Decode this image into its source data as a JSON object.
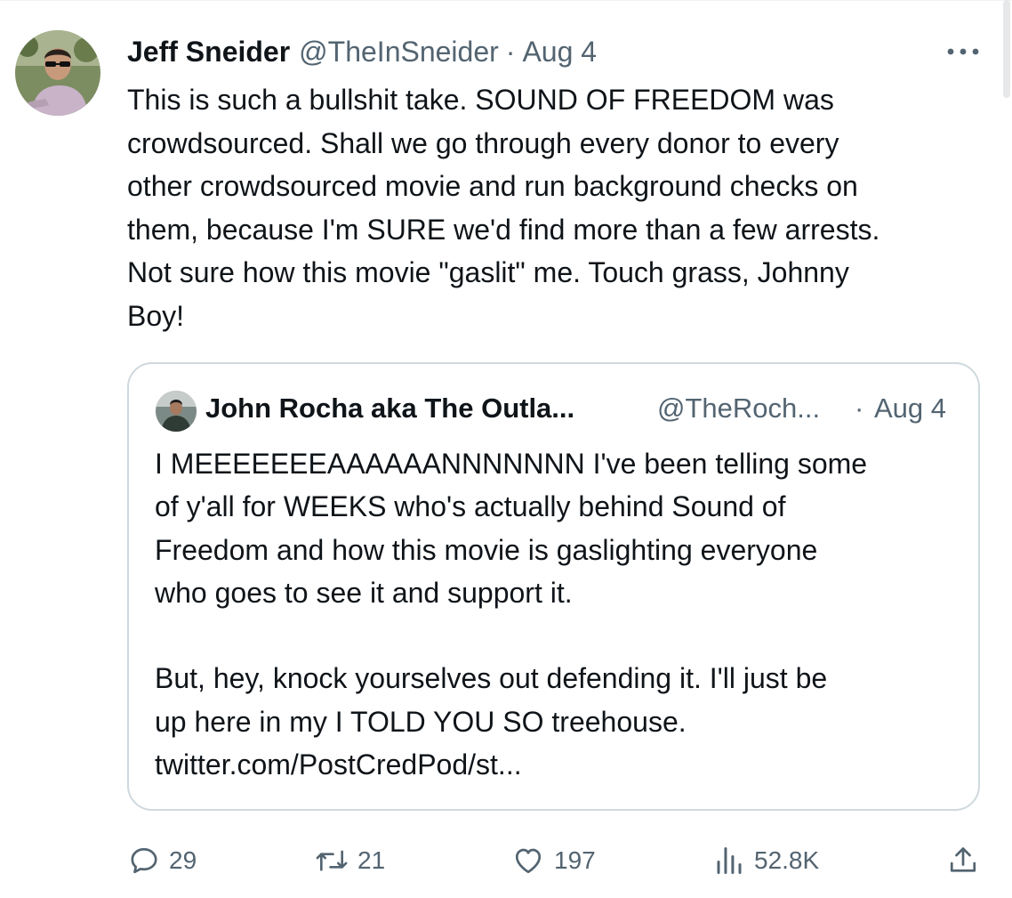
{
  "tweet": {
    "author_name": "Jeff Sneider",
    "author_handle": "@TheInSneider",
    "separator": "·",
    "date": "Aug 4",
    "text_lines": [
      "This is such a bullshit take. SOUND OF FREEDOM was",
      "crowdsourced. Shall we go through every donor to every",
      "other crowdsourced movie and run background checks on",
      "them, because I'm SURE we'd find more than a few arrests.",
      "Not sure how this movie \"gaslit\" me. Touch grass, Johnny",
      "Boy!"
    ],
    "more_icon": "more-horizontal-icon",
    "avatar": "user-avatar"
  },
  "quote": {
    "author_name": "John Rocha aka The Outla...",
    "author_handle": "@TheRoch...",
    "separator": "·",
    "date": "Aug 4",
    "avatar": "user-avatar",
    "paragraph1_lines": [
      "I MEEEEEEEAAAAAANNNNNNN I've been telling some",
      "of y'all for WEEKS who's actually behind Sound of",
      "Freedom and how this movie is gaslighting everyone",
      "who goes to see it and support it."
    ],
    "paragraph2_lines": [
      "But, hey, knock yourselves out defending it. I'll just be",
      "up here in my I TOLD YOU SO treehouse."
    ],
    "link": "twitter.com/PostCredPod/st..."
  },
  "actions": {
    "replies": {
      "icon": "reply-icon",
      "count": "29"
    },
    "retweets": {
      "icon": "retweet-icon",
      "count": "21"
    },
    "likes": {
      "icon": "heart-icon",
      "count": "197"
    },
    "views": {
      "icon": "views-chart-icon",
      "count": "52.8K"
    },
    "share": {
      "icon": "share-icon"
    }
  },
  "colors": {
    "text": "#0f1419",
    "muted": "#536471",
    "border": "#cfd9de"
  }
}
